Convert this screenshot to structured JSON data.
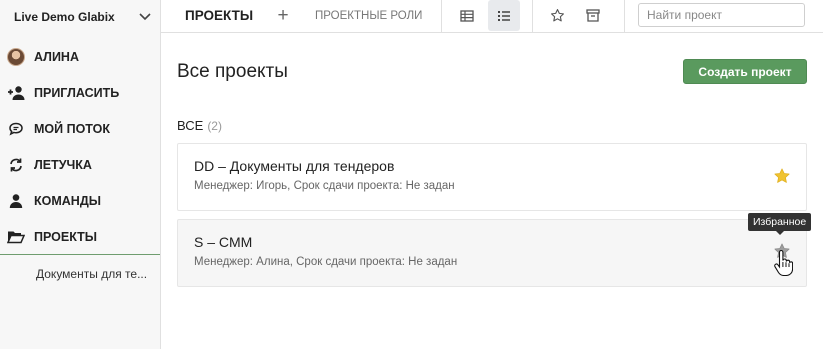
{
  "sidebar": {
    "workspace": "Live Demo Glabix",
    "items": [
      {
        "label": "АЛИНА",
        "icon": "avatar"
      },
      {
        "label": "ПРИГЛАСИТЬ",
        "icon": "add-user-icon"
      },
      {
        "label": "МОЙ ПОТОК",
        "icon": "chat-icon"
      },
      {
        "label": "ЛЕТУЧКА",
        "icon": "refresh-icon"
      },
      {
        "label": "КОМАНДЫ",
        "icon": "user-icon"
      },
      {
        "label": "ПРОЕКТЫ",
        "icon": "folder-open-icon"
      }
    ],
    "subitem": "Документы для те..."
  },
  "header": {
    "tab_projects": "ПРОЕКТЫ",
    "plus": "+",
    "tab_roles": "ПРОЕКТНЫЕ РОЛИ",
    "search_placeholder": "Найти проект"
  },
  "main": {
    "title": "Все проекты",
    "create_button": "Создать проект",
    "section_label": "ВСЕ",
    "section_count": "(2)",
    "projects": [
      {
        "title": "DD – Документы для тендеров",
        "meta": "Менеджер: Игорь, Срок сдачи проекта: Не задан",
        "favorite": true
      },
      {
        "title": "S – CMM",
        "meta": "Менеджер: Алина, Срок сдачи проекта: Не задан",
        "favorite": false
      }
    ],
    "tooltip": "Избранное"
  },
  "colors": {
    "accent_green": "#5a9a5e",
    "star_gold": "#f0c330",
    "star_gray": "#9e9e9e"
  }
}
